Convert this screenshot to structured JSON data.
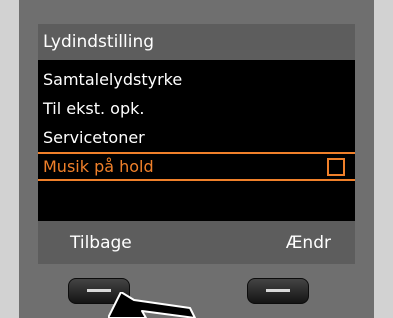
{
  "header": {
    "title": "Lydindstilling"
  },
  "menu": {
    "items": [
      {
        "label": "Samtalelydstyrke",
        "selected": false
      },
      {
        "label": "Til ekst. opk.",
        "selected": false
      },
      {
        "label": "Servicetoner",
        "selected": false
      },
      {
        "label": "Musik på hold",
        "selected": true,
        "checked": false
      }
    ]
  },
  "softkeys": {
    "left": "Tilbage",
    "right": "Ændr"
  },
  "colors": {
    "accent": "#f0802a",
    "bar": "#5d5d5d",
    "screen": "#000000",
    "bezel": "#6f6f6f"
  },
  "icons": {
    "checkbox": "checkbox-unchecked-icon",
    "softkey": "dash-icon",
    "pointer": "arrow-pointer-icon"
  }
}
